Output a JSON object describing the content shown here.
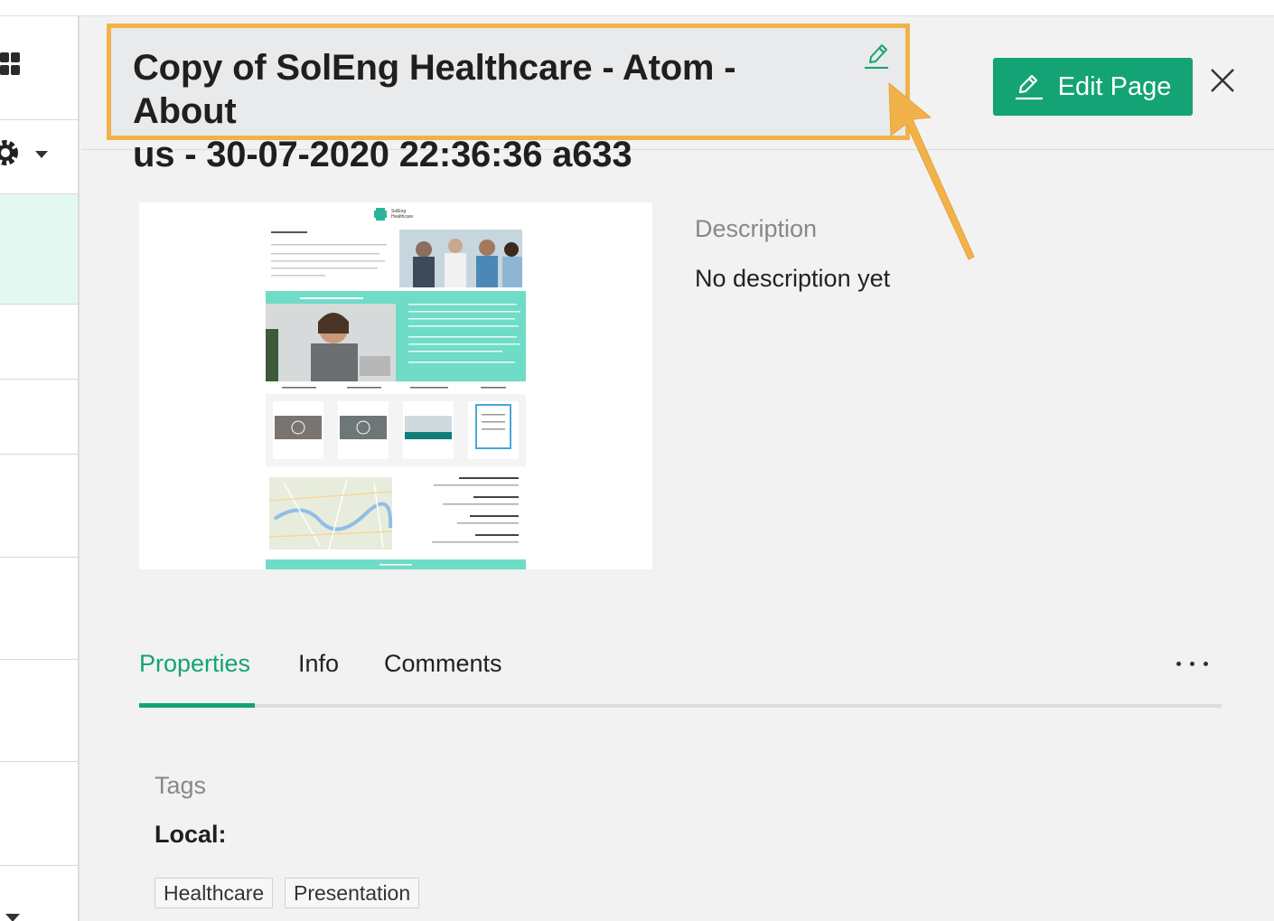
{
  "header": {
    "title_line1": "Copy of SolEng Healthcare - Atom - About",
    "title_line2": "us - 30-07-2020 22:36:36 a633",
    "edit_page_label": "Edit Page"
  },
  "description": {
    "label": "Description",
    "value": "No description yet"
  },
  "tabs": [
    {
      "label": "Properties",
      "active": true
    },
    {
      "label": "Info",
      "active": false
    },
    {
      "label": "Comments",
      "active": false
    }
  ],
  "properties": {
    "tags_label": "Tags",
    "local_label": "Local:",
    "tags": [
      "Healthcare",
      "Presentation"
    ]
  },
  "colors": {
    "accent": "#14a374",
    "highlight": "#f2b24a",
    "active_row": "#e3f8f1"
  },
  "preview": {
    "brand": "SolEng Healthcare"
  }
}
